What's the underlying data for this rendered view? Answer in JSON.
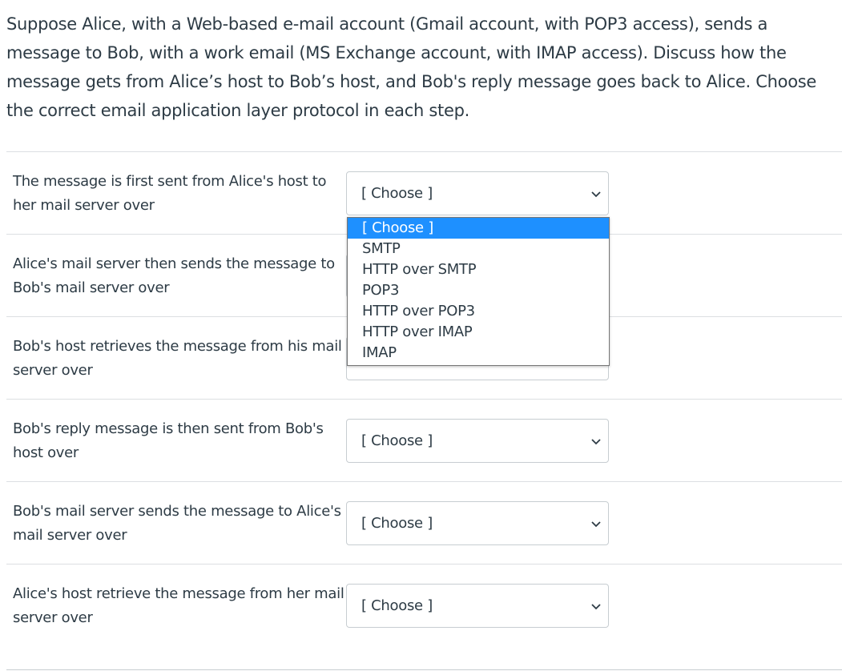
{
  "question": {
    "text": "Suppose Alice, with a Web-based e-mail account (Gmail account, with POP3 access), sends a message to Bob, with a work email (MS Exchange account, with IMAP access). Discuss how the message gets from Alice’s host to Bob’s host, and Bob's reply message goes back to Alice. Choose the correct email application layer protocol in each step."
  },
  "rows": [
    {
      "label": "The message is first sent from Alice's host to her mail server over",
      "selected": "[ Choose ]"
    },
    {
      "label": "Alice's mail server then sends the message to Bob's mail server over",
      "selected": ""
    },
    {
      "label": "Bob's host retrieves the message from his mail server over",
      "selected": ""
    },
    {
      "label": "Bob's reply message is then sent from Bob's host over",
      "selected": "[ Choose ]"
    },
    {
      "label": "Bob's mail server sends the message to Alice's mail server over",
      "selected": "[ Choose ]"
    },
    {
      "label": "Alice's host retrieve the message from her mail server over",
      "selected": "[ Choose ]"
    }
  ],
  "dropdown": {
    "options": [
      "[ Choose ]",
      "SMTP",
      "HTTP over SMTP",
      "POP3",
      "HTTP over POP3",
      "HTTP over IMAP",
      "IMAP"
    ],
    "highlighted": "[ Choose ]"
  },
  "icons": {
    "chevron": "chevron-down-icon"
  },
  "colors": {
    "text": "#2d3b45",
    "highlight": "#1e90ff",
    "border": "#c7cdd1"
  }
}
